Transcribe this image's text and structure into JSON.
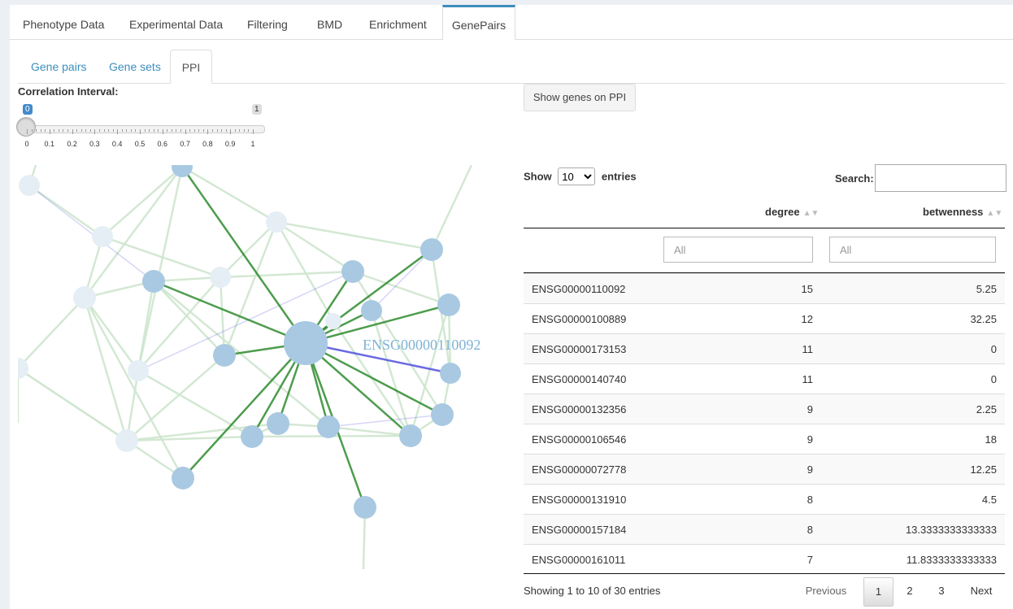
{
  "tabs": [
    "Phenotype Data",
    "Experimental Data",
    "Filtering",
    "BMD",
    "Enrichment",
    "GenePairs"
  ],
  "subtabs": [
    "Gene pairs",
    "Gene sets",
    "PPI"
  ],
  "correlation": {
    "label": "Correlation Interval:",
    "min_badge": "0",
    "max_badge": "1",
    "value": 0,
    "ticks": [
      "0",
      "0.1",
      "0.2",
      "0.3",
      "0.4",
      "0.5",
      "0.6",
      "0.7",
      "0.8",
      "0.9",
      "1"
    ]
  },
  "show_button": "Show genes on PPI",
  "graph": {
    "highlight_label": "ENSG00000110092"
  },
  "table": {
    "show_prefix": "Show",
    "show_value": "10",
    "show_suffix": "entries",
    "search_label": "Search:",
    "search_value": "",
    "columns": [
      "degree",
      "betwenness"
    ],
    "filter_placeholder_degree": "All",
    "filter_placeholder_betw": "All",
    "rows": [
      {
        "gene": "ENSG00000110092",
        "degree": "15",
        "betw": "5.25"
      },
      {
        "gene": "ENSG00000100889",
        "degree": "12",
        "betw": "32.25"
      },
      {
        "gene": "ENSG00000173153",
        "degree": "11",
        "betw": "0"
      },
      {
        "gene": "ENSG00000140740",
        "degree": "11",
        "betw": "0"
      },
      {
        "gene": "ENSG00000132356",
        "degree": "9",
        "betw": "2.25"
      },
      {
        "gene": "ENSG00000106546",
        "degree": "9",
        "betw": "18"
      },
      {
        "gene": "ENSG00000072778",
        "degree": "9",
        "betw": "12.25"
      },
      {
        "gene": "ENSG00000131910",
        "degree": "8",
        "betw": "4.5"
      },
      {
        "gene": "ENSG00000157184",
        "degree": "8",
        "betw": "13.3333333333333"
      },
      {
        "gene": "ENSG00000161011",
        "degree": "7",
        "betw": "11.8333333333333"
      }
    ],
    "info": "Showing 1 to 10 of 30 entries",
    "pagination": {
      "previous": "Previous",
      "pages": [
        "1",
        "2",
        "3"
      ],
      "next": "Next",
      "current": "1"
    }
  },
  "colors": {
    "accent": "#3c8dbc",
    "node": "#a9c9e2",
    "node_faded": "#e6eef5",
    "edge_strong": "#2e8b2e",
    "edge_faint": "#cfe6cf",
    "edge_blue": "#5a5ae0"
  }
}
